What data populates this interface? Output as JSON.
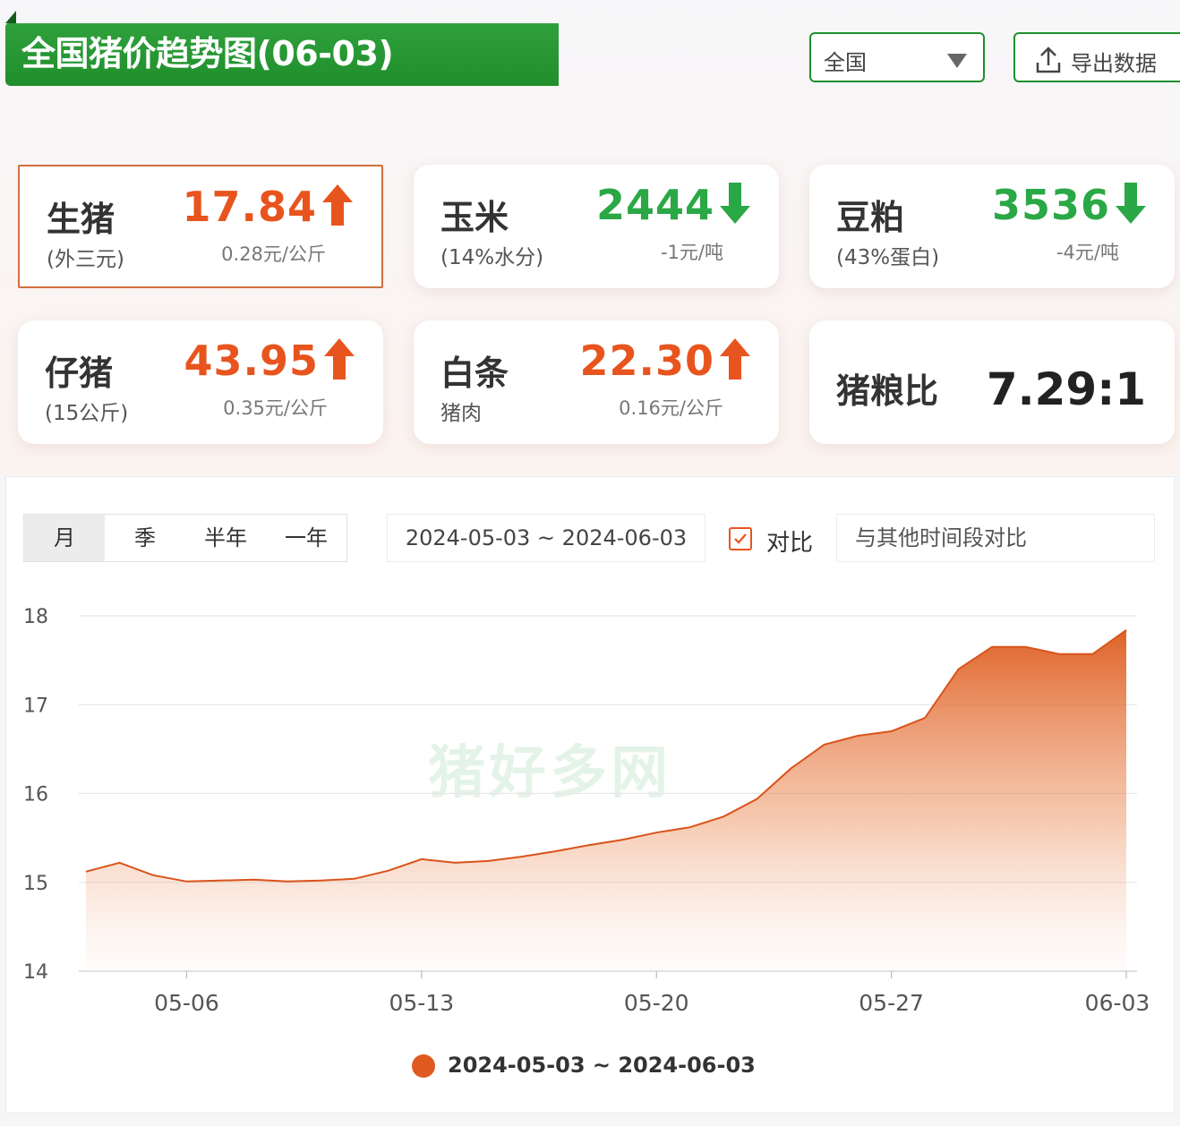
{
  "header": {
    "title": "全国猪价趋势图(06-03)",
    "region_select": "全国",
    "export_label": "导出数据"
  },
  "cards": [
    {
      "name": "生猪",
      "sub": "(外三元)",
      "value": "17.84",
      "change": "0.28元/公斤",
      "trend": "up",
      "selected": true
    },
    {
      "name": "玉米",
      "sub": "(14%水分)",
      "value": "2444",
      "change": "-1元/吨",
      "trend": "down"
    },
    {
      "name": "豆粕",
      "sub": "(43%蛋白)",
      "value": "3536",
      "change": "-4元/吨",
      "trend": "down"
    },
    {
      "name": "仔猪",
      "sub": "(15公斤)",
      "value": "43.95",
      "change": "0.35元/公斤",
      "trend": "up"
    },
    {
      "name": "白条",
      "sub": "猪肉",
      "value": "22.30",
      "change": "0.16元/公斤",
      "trend": "up"
    },
    {
      "name": "猪粮比",
      "value": "7.29:1"
    }
  ],
  "controls": {
    "range_tabs": [
      "月",
      "季",
      "半年",
      "一年"
    ],
    "active_tab": "月",
    "date_range": "2024-05-03 ~ 2024-06-03",
    "compare_label": "对比",
    "compare_placeholder": "与其他时间段对比"
  },
  "watermark": "猪好多网",
  "colors": {
    "brand_green": "#1f8f2c",
    "up": "#e8541e",
    "down": "#2aa845",
    "series": "#e05a20"
  },
  "chart_data": {
    "type": "area",
    "x": [
      "2024-05-03",
      "2024-05-04",
      "2024-05-05",
      "2024-05-06",
      "2024-05-07",
      "2024-05-08",
      "2024-05-09",
      "2024-05-10",
      "2024-05-11",
      "2024-05-12",
      "2024-05-13",
      "2024-05-14",
      "2024-05-15",
      "2024-05-16",
      "2024-05-17",
      "2024-05-18",
      "2024-05-19",
      "2024-05-20",
      "2024-05-21",
      "2024-05-22",
      "2024-05-23",
      "2024-05-24",
      "2024-05-25",
      "2024-05-26",
      "2024-05-27",
      "2024-05-28",
      "2024-05-29",
      "2024-05-30",
      "2024-05-31",
      "2024-06-01",
      "2024-06-02",
      "2024-06-03"
    ],
    "series": [
      {
        "name": "2024-05-03 ~ 2024-06-03",
        "values": [
          15.12,
          15.22,
          15.08,
          15.01,
          15.02,
          15.03,
          15.01,
          15.02,
          15.04,
          15.13,
          15.26,
          15.22,
          15.24,
          15.29,
          15.35,
          15.42,
          15.48,
          15.56,
          15.62,
          15.74,
          15.94,
          16.28,
          16.55,
          16.65,
          16.7,
          16.85,
          17.4,
          17.65,
          17.65,
          17.57,
          17.57,
          17.84
        ]
      }
    ],
    "xticks": [
      "05-06",
      "05-13",
      "05-20",
      "05-27",
      "06-03"
    ],
    "yticks": [
      14,
      15,
      16,
      17,
      18
    ],
    "ylim": [
      14,
      18
    ],
    "grid": true,
    "legend_position": "bottom"
  }
}
